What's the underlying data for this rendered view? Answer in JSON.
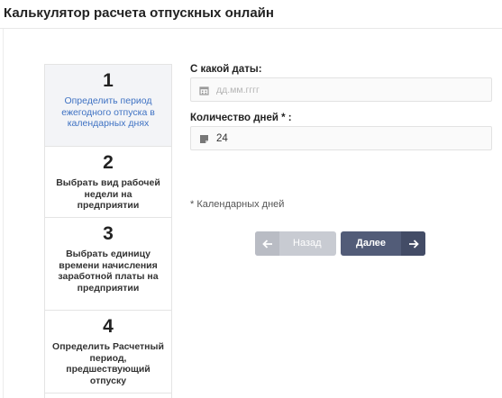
{
  "title": "Калькулятор расчета отпускных онлайн",
  "steps": [
    {
      "num": "1",
      "text": "Определить период ежегодного отпуска в календарных днях",
      "active": true
    },
    {
      "num": "2",
      "text": "Выбрать вид рабочей недели на предприятии",
      "active": false
    },
    {
      "num": "3",
      "text": "Выбрать единицу времени начисления заработной платы на предприятии",
      "active": false
    },
    {
      "num": "4",
      "text": "Определить Расчетный период, предшествующий отпуску",
      "active": false
    }
  ],
  "form": {
    "date_label": "С какой даты:",
    "date_placeholder": "дд.мм.гггг",
    "date_icon": "calendar-icon",
    "days_label": "Количество дней * :",
    "days_value": "24",
    "days_icon": "note-icon",
    "note": "* Календарных дней"
  },
  "buttons": {
    "back_label": "Назад",
    "next_label": "Далее"
  },
  "colors": {
    "accent_text": "#3f72c3",
    "next_button": "#525c78",
    "back_button": "#c8cbd2"
  }
}
